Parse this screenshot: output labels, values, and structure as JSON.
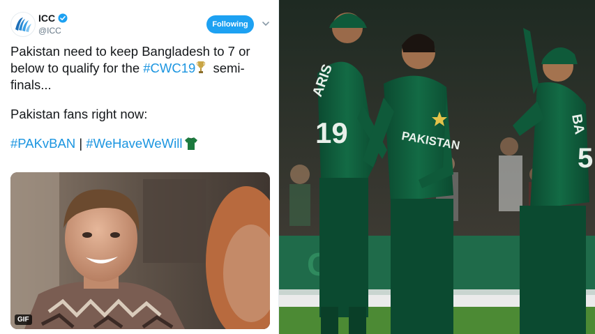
{
  "tweet": {
    "author_name": "ICC",
    "author_handle": "@ICC",
    "follow_label": "Following",
    "line1": "Pakistan need to keep Bangladesh to 7 or below to qualify for the ",
    "hashtag_cwc": "#CWC19",
    "line1_end": " semi-finals...",
    "line2": "Pakistan fans right now:",
    "hashtag_pakvban": "#PAKvBAN",
    "separator": " | ",
    "hashtag_wehave": "#WeHaveWeWill",
    "media_badge": "GIF",
    "icons": [
      "icc-logo-icon",
      "verified-badge-icon",
      "chevron-down-icon",
      "trophy-emoji-icon",
      "green-jersey-emoji-icon"
    ],
    "colors": {
      "accent": "#1da1f2",
      "hashtag": "#1b95e0",
      "text": "#14171a",
      "muted": "#657786"
    }
  },
  "photo": {
    "jersey_texts": {
      "left_player_name": "ARIS",
      "left_player_number": "19",
      "center_chest": "PAKISTAN",
      "right_player_name": "BA",
      "right_player_number": "5"
    },
    "board_text": "Go",
    "colors": {
      "jersey": "#0f5a3a",
      "outfield": "#4c8a34",
      "board": "#1f6b4a"
    }
  }
}
